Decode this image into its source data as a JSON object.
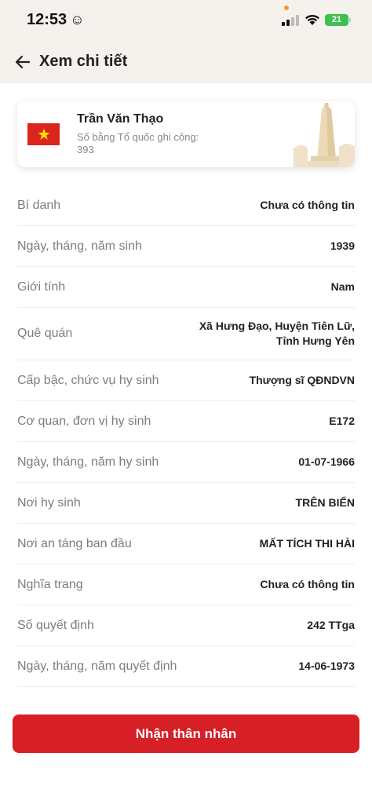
{
  "status_bar": {
    "time": "12:53",
    "battery": "21"
  },
  "header": {
    "title": "Xem chi tiết"
  },
  "profile": {
    "name": "Trần Văn Thạo",
    "certificate_label": "Số bằng Tổ quốc ghi công:",
    "certificate_number": "393"
  },
  "details": [
    {
      "label": "Bí danh",
      "value": "Chưa có thông tin"
    },
    {
      "label": "Ngày, tháng, năm sinh",
      "value": "1939"
    },
    {
      "label": "Giới tính",
      "value": "Nam"
    },
    {
      "label": "Quê quán",
      "value_line1": "Xã Hưng Đạo, Huyện Tiên Lữ,",
      "value_line2": "Tỉnh Hưng Yên"
    },
    {
      "label": "Cấp bậc, chức vụ hy sinh",
      "value": "Thượng sĩ QĐNDVN"
    },
    {
      "label": "Cơ quan, đơn vị hy sinh",
      "value": "E172"
    },
    {
      "label": "Ngày, tháng, năm hy sinh",
      "value": "01-07-1966"
    },
    {
      "label": "Nơi hy sinh",
      "value": "TRÊN BIỂN"
    },
    {
      "label": "Nơi an táng ban đầu",
      "value": "MẤT TÍCH THI HÀI"
    },
    {
      "label": "Nghĩa trang",
      "value": "Chưa có thông tin"
    },
    {
      "label": "Số quyết định",
      "value": "242 TTga"
    },
    {
      "label": "Ngày, tháng, năm quyết định",
      "value": "14-06-1973"
    }
  ],
  "cta": {
    "label": "Nhận thân nhân"
  },
  "colors": {
    "accent": "#d71f26",
    "header_bg": "#f5f1ec",
    "flag_red": "#da251d",
    "flag_star": "#ffde00"
  },
  "icons": {
    "back": "arrow-left-icon",
    "smiley": "smiley-icon",
    "signal": "cellular-signal-icon",
    "wifi": "wifi-icon",
    "battery": "battery-icon"
  }
}
